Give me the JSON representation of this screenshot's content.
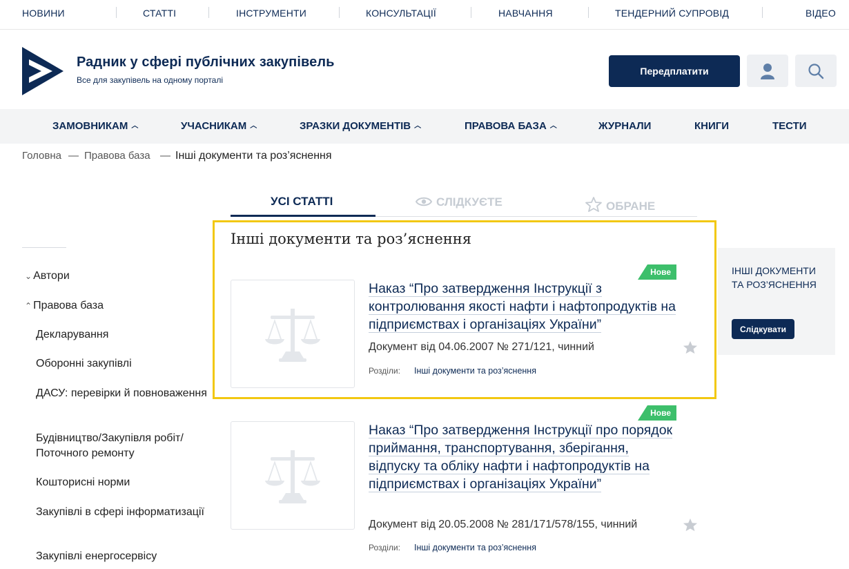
{
  "topnav": [
    "НОВИНИ",
    "СТАТТІ",
    "ІНСТРУМЕНТИ",
    "КОНСУЛЬТАЦІЇ",
    "НАВЧАННЯ",
    "ТЕНДЕРНИЙ СУПРОВІД",
    "ВІДЕО"
  ],
  "header": {
    "title": "Радник у сфері публічних закупівель",
    "subtitle": "Все для закупівель на одному порталі",
    "subscribe": "Передплатити"
  },
  "mainnav": [
    "ЗАМОВНИКАМ",
    "УЧАСНИКАМ",
    "ЗРАЗКИ ДОКУМЕНТІВ",
    "ПРАВОВА БАЗА",
    "ЖУРНАЛИ",
    "КНИГИ",
    "ТЕСТИ"
  ],
  "breadcrumb": {
    "home": "Головна",
    "sep": "—",
    "section": "Правова база",
    "current": "Інші документи та роз’яснення"
  },
  "tabs": {
    "all": "УСІ СТАТТІ",
    "following": "СЛІДКУЄТЕ",
    "favorites": "ОБРАНЕ"
  },
  "section_title": "Інші документи та роз’яснення",
  "sidebar": {
    "authors": "Автори",
    "legal": "Правова база",
    "items": [
      "Декларування",
      "Оборонні закупівлі",
      "ДАСУ: перевірки й повноваження",
      "Будівництво/Закупівля робіт/ Поточного ремонту",
      "Кошторисні норми",
      "Закупівлі в сфері інформатизації",
      "Закупівлі енергосервісу"
    ]
  },
  "articles": [
    {
      "badge": "Нове",
      "title": "Наказ “Про затвердження Інструкції з контролювання якості нафти і нафтопродуктів на підприємствах і організаціях України”",
      "meta": "Документ від 04.06.2007 № 271/121, чинний",
      "sections_label": "Розділи:",
      "section_link": "Інші документи та роз’яснення"
    },
    {
      "badge": "Нове",
      "title": "Наказ “Про затвердження Інструкції про порядок приймання, транспортування, зберігання, відпуску та обліку нафти і нафтопродуктів на підприємствах і організаціях України”",
      "meta": "Документ від 20.05.2008 № 281/171/578/155, чинний",
      "sections_label": "Розділи:",
      "section_link": "Інші документи та роз’яснення"
    }
  ],
  "right_panel": {
    "title": "ІНШІ ДОКУМЕНТИ ТА РОЗ’ЯСНЕННЯ",
    "follow": "Слідкувати"
  },
  "colors": {
    "brand": "#0d2a55",
    "highlight": "#f2c811",
    "badge": "#3dbf6b"
  }
}
